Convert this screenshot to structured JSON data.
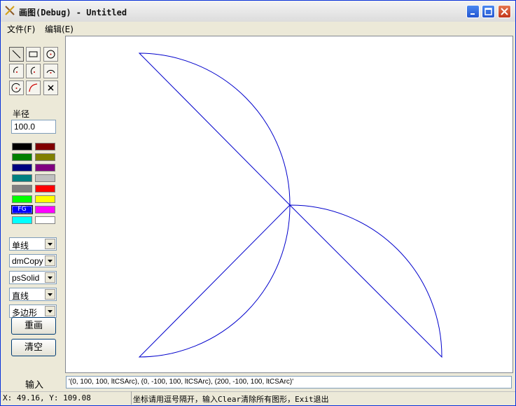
{
  "window": {
    "title": "画图(Debug) - Untitled"
  },
  "menu": {
    "file": "文件(F)",
    "edit": "编辑(E)"
  },
  "tools": [
    "line-tool",
    "rectangle-tool",
    "circle-tool",
    "arc-tool-1",
    "arc-tool-2",
    "arc-tool-3",
    "circle-arc-tool",
    "curve-tool",
    "delete-tool"
  ],
  "radius": {
    "label": "半径",
    "value": "100.0"
  },
  "palette": {
    "colors": [
      "#000000",
      "#800000",
      "#008000",
      "#808000",
      "#000080",
      "#800080",
      "#008080",
      "#c0c0c0",
      "#808080",
      "#ff0000",
      "#00ff00",
      "#ffff00",
      "#0000ff",
      "#ff00ff",
      "#00ffff",
      "#ffffff"
    ],
    "fg_label": "FG"
  },
  "dropdowns": {
    "line_type": "单线",
    "pen_mode": "dmCopy",
    "pen_style": "psSolid",
    "shape": "直线",
    "fill": "多边形"
  },
  "buttons": {
    "redraw": "重画",
    "clear": "清空"
  },
  "input": {
    "label": "输入",
    "value": "'(0, 100, 100, ltCSArc), (0, -100, 100, ltCSArc), (200, -100, 100, ltCSArc)'"
  },
  "status": {
    "coords": "X: 49.16, Y: 109.08",
    "hint": "坐标请用逗号隔开，输入Clear清除所有图形，Exit退出"
  },
  "drawing_color": "#0000cc"
}
